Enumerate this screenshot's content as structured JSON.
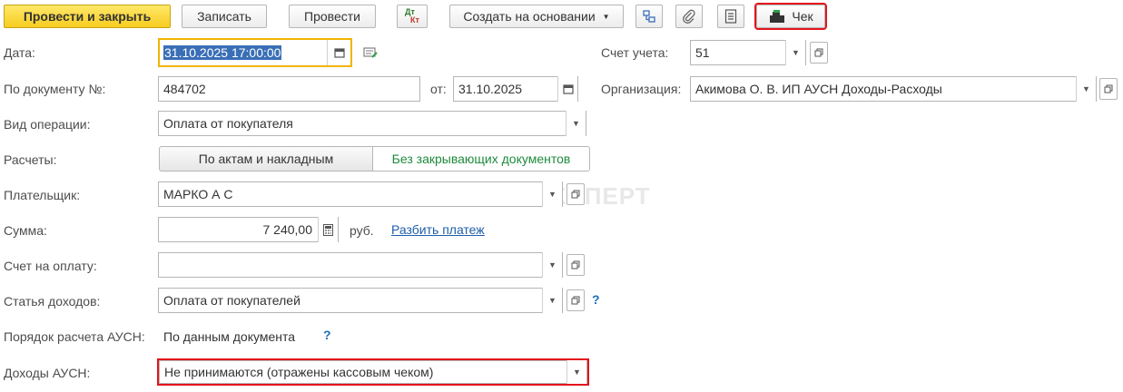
{
  "toolbar": {
    "post_close_label": "Провести и закрыть",
    "save_label": "Записать",
    "post_label": "Провести",
    "dt_kt_top": "Дт",
    "dt_kt_bottom": "Кт",
    "create_based_label": "Создать на основании",
    "receipt_label": "Чек"
  },
  "form": {
    "date": {
      "label": "Дата:",
      "value": "31.10.2025 17:00:00"
    },
    "account": {
      "label": "Счет учета:",
      "value": "51"
    },
    "doc_number": {
      "label": "По документу №:",
      "value": "484702",
      "from_label": "от:",
      "from_value": "31.10.2025"
    },
    "organization": {
      "label": "Организация:",
      "value": "Акимова О. В. ИП АУСН Доходы-Расходы"
    },
    "operation_type": {
      "label": "Вид операции:",
      "value": "Оплата от покупателя"
    },
    "settlements": {
      "label": "Расчеты:",
      "option_acts": "По актам и накладным",
      "option_no_docs": "Без закрывающих документов"
    },
    "payer": {
      "label": "Плательщик:",
      "value": "МАРКО А С"
    },
    "amount": {
      "label": "Сумма:",
      "value": "7 240,00",
      "currency": "руб.",
      "split_link": "Разбить платеж"
    },
    "invoice": {
      "label": "Счет на оплату:",
      "value": ""
    },
    "income_item": {
      "label": "Статья доходов:",
      "value": "Оплата от покупателей",
      "help": "?"
    },
    "ausn_calc": {
      "label": "Порядок расчета АУСН:",
      "value": "По данным документа",
      "help": "?"
    },
    "ausn_income": {
      "label": "Доходы АУСН:",
      "value": "Не принимаются (отражены кассовым чеком)"
    }
  },
  "watermark": "БУХЭКСПЕРТ",
  "colors": {
    "accent_yellow": "#f6cc1f",
    "highlight_red": "#e4141d",
    "link_blue": "#1f5ea8",
    "active_green": "#1e8a3c",
    "focus_border": "#f0b400"
  }
}
